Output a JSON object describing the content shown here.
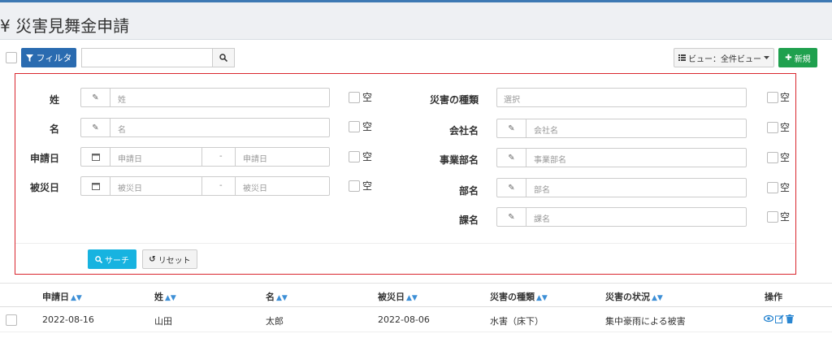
{
  "header": {
    "title_icon": "¥",
    "title": "災害見舞金申請"
  },
  "toolbar": {
    "filter_label": "フィルタ",
    "search_value": "",
    "view_label": "ビュー：全件ビュー",
    "new_label": "新規"
  },
  "filters": {
    "sei": {
      "label": "姓",
      "placeholder": "姓",
      "empty": "空"
    },
    "mei": {
      "label": "名",
      "placeholder": "名",
      "empty": "空"
    },
    "apply_date": {
      "label": "申請日",
      "from_placeholder": "申請日",
      "to_placeholder": "申請日",
      "separator": "-",
      "empty": "空"
    },
    "disaster_date": {
      "label": "被災日",
      "from_placeholder": "被災日",
      "to_placeholder": "被災日",
      "separator": "-",
      "empty": "空"
    },
    "disaster_type": {
      "label": "災害の種類",
      "placeholder": "選択",
      "empty": "空"
    },
    "company": {
      "label": "会社名",
      "placeholder": "会社名",
      "empty": "空"
    },
    "division": {
      "label": "事業部名",
      "placeholder": "事業部名",
      "empty": "空"
    },
    "department": {
      "label": "部名",
      "placeholder": "部名",
      "empty": "空"
    },
    "section": {
      "label": "課名",
      "placeholder": "課名",
      "empty": "空"
    },
    "search_label": "サーチ",
    "reset_label": "リセット"
  },
  "table": {
    "columns": [
      "申請日",
      "姓",
      "名",
      "被災日",
      "災害の種類",
      "災害の状況",
      "操作"
    ],
    "rows": [
      {
        "apply_date": "2022-08-16",
        "sei": "山田",
        "mei": "太郎",
        "disaster_date": "2022-08-06",
        "disaster_type": "水害（床下）",
        "situation": "集中豪雨による被害"
      }
    ]
  },
  "icons": {
    "filter": "funnel-icon",
    "search": "magnifier-icon",
    "view": "list-icon",
    "new": "plus-icon",
    "edit_field": "pencil-icon",
    "date_field": "calendar-icon",
    "reset": "undo-icon",
    "sort": "sort-icon",
    "row_view": "eye-icon",
    "row_edit": "edit-icon",
    "row_delete": "trash-icon"
  },
  "colors": {
    "primary": "#2a6bb0",
    "success": "#1fa04e",
    "info": "#17b3e0",
    "highlight_border": "#d9262e",
    "header_stripe": "#3d79b3"
  }
}
